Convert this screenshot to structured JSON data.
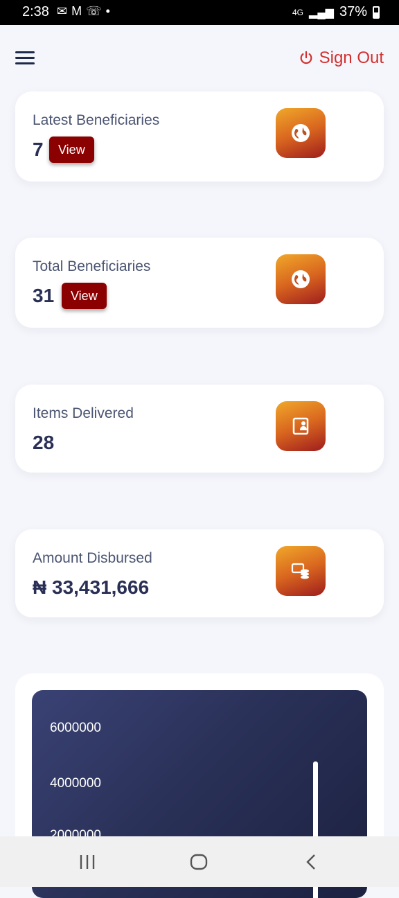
{
  "status": {
    "time": "2:38",
    "network": "4G",
    "battery": "37%"
  },
  "header": {
    "sign_out_label": "Sign Out"
  },
  "cards": [
    {
      "label": "Latest Beneficiaries",
      "value": "7",
      "button": "View",
      "icon": "globe-icon"
    },
    {
      "label": "Total Beneficiaries",
      "value": "31",
      "button": "View",
      "icon": "globe-icon"
    },
    {
      "label": "Items Delivered",
      "value": "28",
      "icon": "delivery-icon"
    },
    {
      "label": "Amount Disbursed",
      "value": "₦ 33,431,666",
      "icon": "money-stack-icon"
    }
  ],
  "chart_data": {
    "type": "bar",
    "y_ticks": [
      "6000000",
      "4000000",
      "2000000"
    ],
    "ylim": [
      0,
      6000000
    ]
  }
}
